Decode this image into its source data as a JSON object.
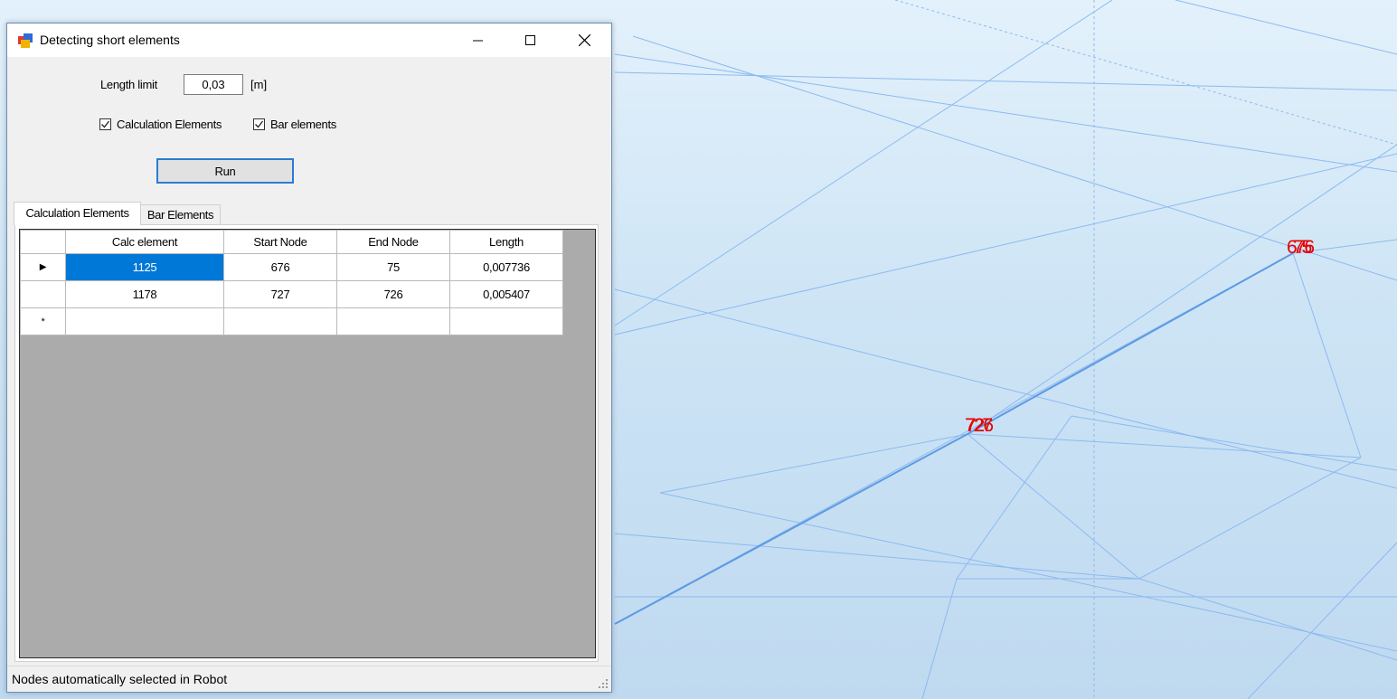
{
  "window": {
    "title": "Detecting short elements"
  },
  "form": {
    "length_limit_label": "Length limit",
    "length_limit_value": "0,03",
    "length_unit": "[m]",
    "checkbox_calc_label": "Calculation Elements",
    "checkbox_calc_checked": true,
    "checkbox_bar_label": "Bar elements",
    "checkbox_bar_checked": true,
    "run_label": "Run"
  },
  "tabs": [
    {
      "label": "Calculation Elements",
      "active": true
    },
    {
      "label": "Bar Elements",
      "active": false
    }
  ],
  "grid": {
    "columns": [
      "Calc element",
      "Start Node",
      "End Node",
      "Length"
    ],
    "rows": [
      {
        "marker": "▶",
        "cells": [
          "1125",
          "676",
          "75",
          "0,007736"
        ]
      },
      {
        "marker": "",
        "cells": [
          "1178",
          "727",
          "726",
          "0,005407"
        ]
      },
      {
        "marker": "*",
        "cells": [
          "",
          "",
          "",
          ""
        ]
      }
    ]
  },
  "status": {
    "text": "Nodes automatically selected in Robot"
  },
  "viewport": {
    "node_labels": [
      {
        "a": "676",
        "b": "75"
      },
      {
        "a": "727",
        "b": "726"
      }
    ],
    "label_color": "#e60000",
    "line_color": "#7fb3ea"
  }
}
